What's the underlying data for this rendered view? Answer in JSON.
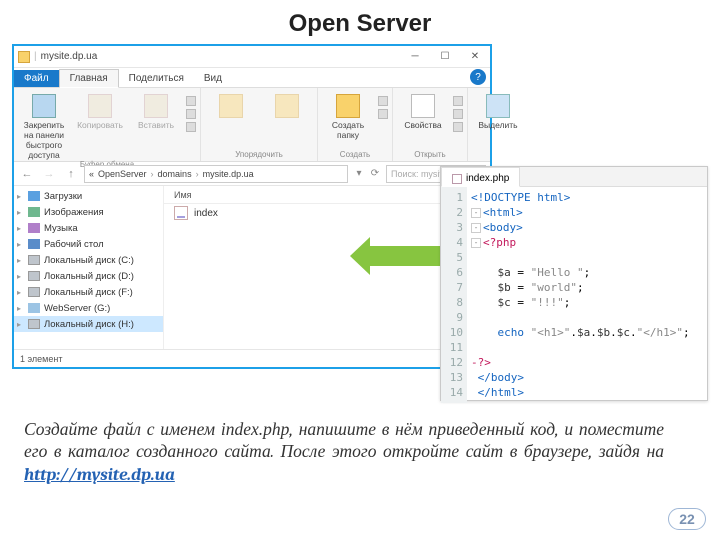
{
  "slide": {
    "title": "Open Server",
    "page": "22"
  },
  "explorer": {
    "window_title": "mysite.dp.ua",
    "tabs": {
      "file": "Файл",
      "home": "Главная",
      "share": "Поделиться",
      "view": "Вид"
    },
    "ribbon": {
      "pin": "Закрепить на панели\nбыстрого доступа",
      "copy": "Копировать",
      "paste": "Вставить",
      "group_clipboard": "Буфер обмена",
      "group_organize": "Упорядочить",
      "new_folder": "Создать\nпапку",
      "group_new": "Создать",
      "properties": "Свойства",
      "group_open": "Открыть",
      "select": "Выделить"
    },
    "breadcrumb": [
      "OpenServer",
      "domains",
      "mysite.dp.ua"
    ],
    "search_placeholder": "Поиск: mysite…",
    "column_name": "Имя",
    "sidebar": [
      {
        "label": "Загрузки",
        "ico": "dl"
      },
      {
        "label": "Изображения",
        "ico": "img"
      },
      {
        "label": "Музыка",
        "ico": "mus"
      },
      {
        "label": "Рабочий стол",
        "ico": "desk"
      },
      {
        "label": "Локальный диск (C:)",
        "ico": "drv"
      },
      {
        "label": "Локальный диск (D:)",
        "ico": "drv"
      },
      {
        "label": "Локальный диск (F:)",
        "ico": "drv"
      },
      {
        "label": "WebServer (G:)",
        "ico": "net"
      },
      {
        "label": "Локальный диск (H:)",
        "ico": "drv",
        "selected": true
      }
    ],
    "file": "index",
    "status": "1 элемент"
  },
  "editor": {
    "tab": "index.php",
    "lines": [
      {
        "n": "1",
        "html": "<span class='tag'>&lt;!DOCTYPE html&gt;</span>"
      },
      {
        "n": "2",
        "html": "<span class='fold'>-</span><span class='tag'>&lt;html&gt;</span>"
      },
      {
        "n": "3",
        "html": "<span class='fold'>-</span><span class='tag'>&lt;body&gt;</span>"
      },
      {
        "n": "4",
        "html": "<span class='fold'>-</span><span class='php'>&lt;?php</span>"
      },
      {
        "n": "5",
        "html": " "
      },
      {
        "n": "6",
        "html": "    <span class='var'>$a</span> = <span class='str'>\"Hello \"</span>;"
      },
      {
        "n": "7",
        "html": "    <span class='var'>$b</span> = <span class='str'>\"world\"</span>;"
      },
      {
        "n": "8",
        "html": "    <span class='var'>$c</span> = <span class='str'>\"!!!\"</span>;"
      },
      {
        "n": "9",
        "html": " "
      },
      {
        "n": "10",
        "html": "    <span class='kw'>echo</span> <span class='str'>\"&lt;h1&gt;\"</span>.<span class='var'>$a</span>.<span class='var'>$b</span>.<span class='var'>$c</span>.<span class='str'>\"&lt;/h1&gt;\"</span>;"
      },
      {
        "n": "11",
        "html": " "
      },
      {
        "n": "12",
        "html": "<span class='php'>-?&gt;</span>"
      },
      {
        "n": "13",
        "html": " <span class='tag'>&lt;/body&gt;</span>"
      },
      {
        "n": "14",
        "html": " <span class='tag'>&lt;/html&gt;</span>"
      }
    ]
  },
  "caption": {
    "t1": "Создайте файл с именем ",
    "fname": "index.php",
    "t2": ", напишите в нём приведенный код, и поместите его в каталог созданного сайта. После этого откройте сайт в браузере, зайдя на ",
    "url": "http://mysite.dp.ua"
  }
}
